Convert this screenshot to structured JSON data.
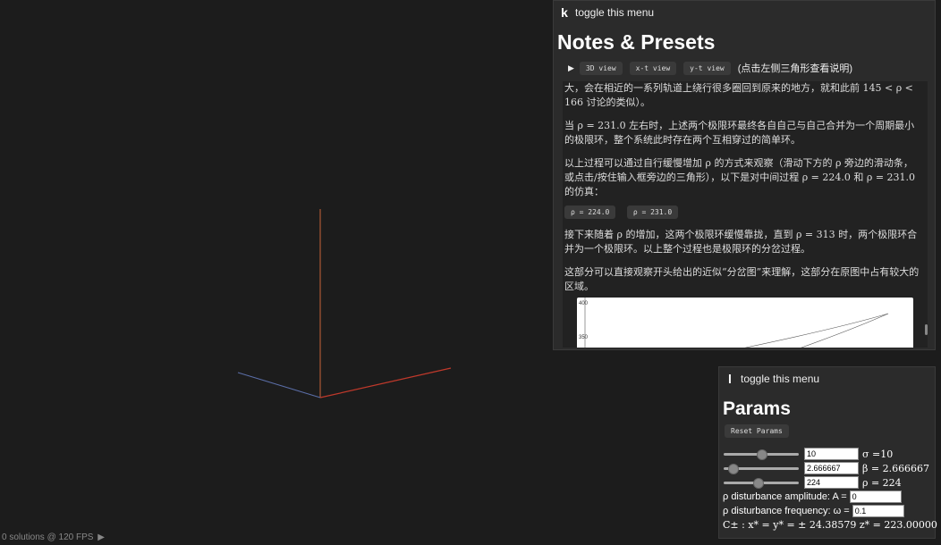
{
  "status": {
    "text": "0 solutions @ 120 FPS",
    "play_icon": "▶"
  },
  "notes_panel": {
    "key": "k",
    "toggle_label": "toggle this menu",
    "title": "Notes & Presets",
    "views": [
      "3D view",
      "x-t view",
      "y-t view"
    ],
    "views_hint": "(点击左侧三角形查看说明)",
    "paragraphs": {
      "p1": "大，会在相近的一系列轨道上绕行很多圈回到原来的地方，就和此前 145 < ρ < 166 讨论的类似）。",
      "p2": "当 ρ = 231.0 左右时，上述两个极限环最终各自自己与自己合并为一个周期最小的极限环，整个系统此时存在两个互相穿过的简单环。",
      "p3": "以上过程可以通过自行缓慢增加 ρ 的方式来观察（滑动下方的 ρ 旁边的滑动条，或点击/按住输入框旁边的三角形），以下是对中间过程 ρ = 224.0 和 ρ = 231.0 的仿真：",
      "p4": "接下来随着 ρ 的增加，这两个极限环缓慢靠拢，直到 ρ = 313 时，两个极限环合并为一个极限环。以上整个过程也是极限环的分岔过程。",
      "p5": "这部分可以直接观察开头给出的近似“分岔图”来理解，这部分在原图中占有较大的区域。"
    },
    "presets": [
      "ρ = 224.0",
      "ρ = 231.0"
    ],
    "chart_ticks": [
      "400",
      "350"
    ]
  },
  "params_panel": {
    "key": "l",
    "toggle_label": "toggle this menu",
    "title": "Params",
    "reset_label": "Reset Params",
    "sigma": {
      "value": "10",
      "label": "σ =10",
      "fraction": 0.5
    },
    "beta": {
      "value": "2.666667",
      "label": "β = 2.666667",
      "fraction": 0.12
    },
    "rho": {
      "value": "224",
      "label": "ρ = 224",
      "fraction": 0.45
    },
    "amp_label": "ρ disturbance amplitude: A =",
    "amp_value": "0",
    "freq_label": "ρ disturbance frequency: ω =",
    "freq_value": "0.1",
    "cstar": "C± : x* = y* = ± 24.38579 z* = 223.00000"
  },
  "colors": {
    "axis_y": "#c8643a",
    "axis_x": "#c0392b",
    "axis_z": "#5b6ea8"
  }
}
